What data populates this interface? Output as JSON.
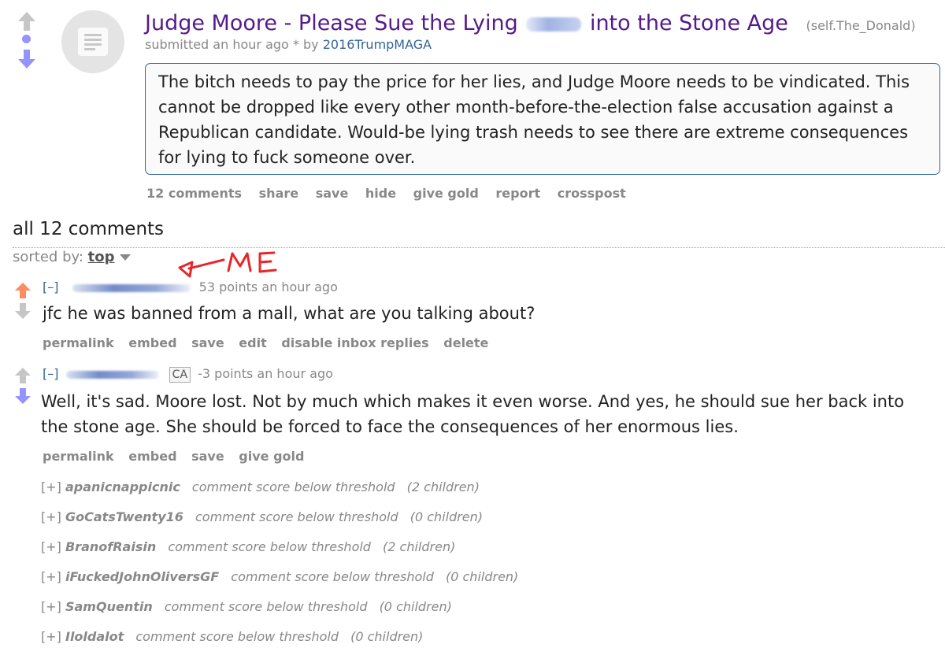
{
  "post": {
    "title_before": "Judge Moore - Please Sue the Lying",
    "title_after": "into the Stone Age",
    "domain": "(self.The_Donald)",
    "submitted": "submitted an hour ago * by ",
    "author": "2016TrumpMAGA",
    "selftext": "The bitch needs to pay the price for her lies, and Judge Moore needs to be vindicated. This cannot be dropped like every other month-before-the-election false accusation against a Republican candidate. Would-be lying trash needs to see there are extreme consequences for lying to fuck someone over.",
    "buttons": [
      "12 comments",
      "share",
      "save",
      "hide",
      "give gold",
      "report",
      "crosspost"
    ]
  },
  "comments_header": {
    "title": "all 12 comments",
    "sorted_label": "sorted by: ",
    "sorted_value": "top"
  },
  "annotation": {
    "text": "ME",
    "color": "#e8262a"
  },
  "comments": [
    {
      "expand": "[–]",
      "points": "53 points an hour ago",
      "body": "jfc he was banned from a mall, what are you talking about?",
      "buttons": [
        "permalink",
        "embed",
        "save",
        "edit",
        "disable inbox replies",
        "delete"
      ]
    },
    {
      "expand": "[–]",
      "flair": "CA",
      "points": "-3 points an hour ago",
      "body": "Well, it's sad. Moore lost. Not by much which makes it even worse. And yes, he should sue her back into the stone age. She should be forced to face the consequences of her enormous lies.",
      "buttons": [
        "permalink",
        "embed",
        "save",
        "give gold"
      ]
    }
  ],
  "collapsed": [
    {
      "expand": "[+]",
      "user": "apanicnappicnic",
      "note": "comment score below threshold",
      "children": "(2 children)"
    },
    {
      "expand": "[+]",
      "user": "GoCatsTwenty16",
      "note": "comment score below threshold",
      "children": "(0 children)"
    },
    {
      "expand": "[+]",
      "user": "BranofRaisin",
      "note": "comment score below threshold",
      "children": "(2 children)"
    },
    {
      "expand": "[+]",
      "user": "iFuckedJohnOliversGF",
      "note": "comment score below threshold",
      "children": "(0 children)"
    },
    {
      "expand": "[+]",
      "user": "SamQuentin",
      "note": "comment score below threshold",
      "children": "(0 children)"
    },
    {
      "expand": "[+]",
      "user": "Iloldalot",
      "note": "comment score below threshold",
      "children": "(0 children)"
    }
  ],
  "colors": {
    "upvote_active": "#ff8b60",
    "downvote_active": "#9494ff",
    "arrow_neutral": "#c6c6c6",
    "title": "#551a8b",
    "link": "#336699"
  }
}
